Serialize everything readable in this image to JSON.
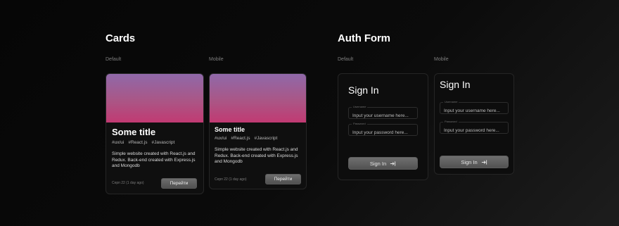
{
  "sections": {
    "cards_title": "Cards",
    "auth_title": "Auth Form"
  },
  "labels": {
    "default": "Default",
    "mobile": "Mobile"
  },
  "card": {
    "title": "Some title",
    "tags": [
      "#ux/ui",
      "#React.js",
      "#Javascript"
    ],
    "description": "Simple website created with React.js and Redux. Back-end created with Express.js and Mongodb",
    "date": "Серп 22 (1 day ago)",
    "button_label": "Перейти"
  },
  "auth": {
    "title": "Sign In",
    "username_label": "Username",
    "username_placeholder": "Input your username here...",
    "password_label": "Password",
    "password_placeholder": "Input your password here...",
    "button_label": "Sign In",
    "button_icon": "login-arrow-icon"
  },
  "colors": {
    "card_gradient": [
      "#8f69a9",
      "#aa5686",
      "#c13a72"
    ],
    "button": "#5e5e5e",
    "panel": "#0f0f0f"
  }
}
